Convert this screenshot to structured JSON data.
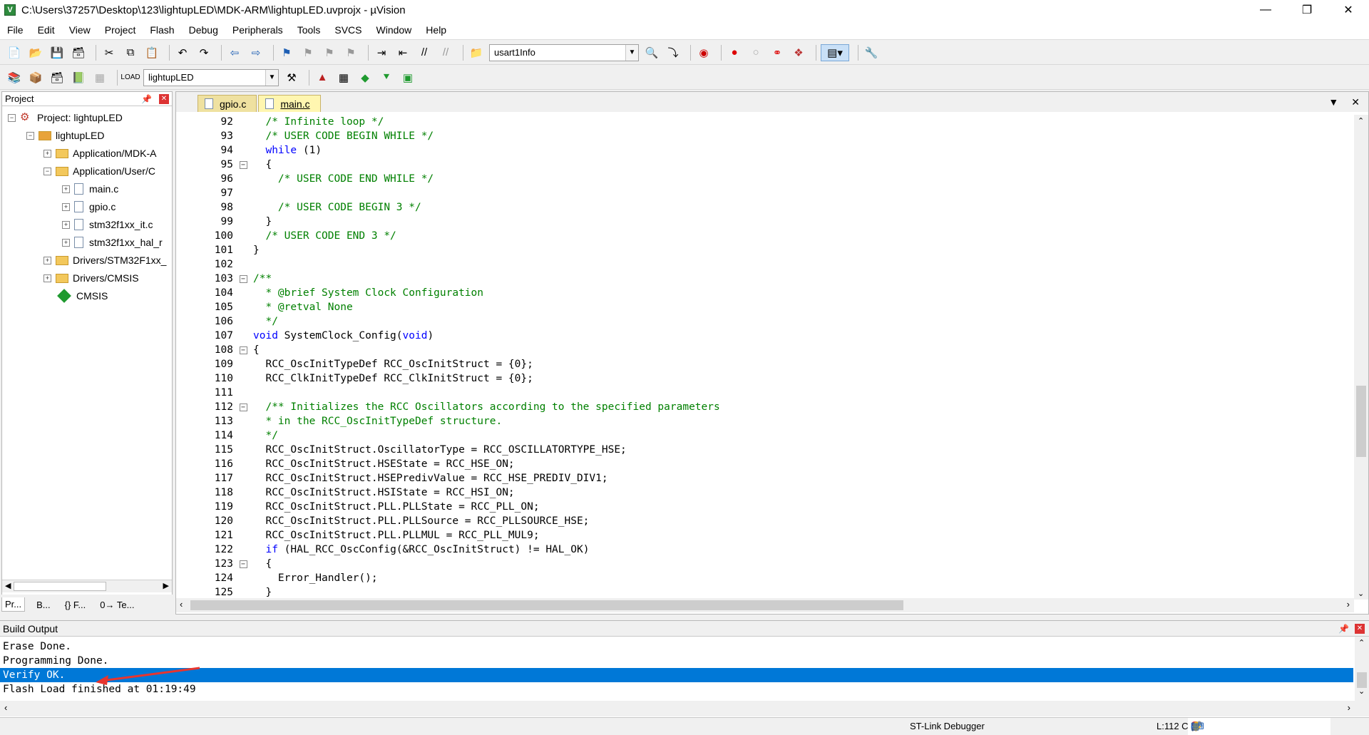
{
  "window": {
    "title": "C:\\Users\\37257\\Desktop\\123\\lightupLED\\MDK-ARM\\lightupLED.uvprojx - µVision"
  },
  "menu": [
    "File",
    "Edit",
    "View",
    "Project",
    "Flash",
    "Debug",
    "Peripherals",
    "Tools",
    "SVCS",
    "Window",
    "Help"
  ],
  "toolbar": {
    "find_combo": "usart1Info",
    "target_combo": "lightupLED"
  },
  "project_panel": {
    "title": "Project",
    "root": "Project: lightupLED",
    "target": "lightupLED",
    "groups": [
      "Application/MDK-A",
      "Application/User/C",
      "main.c",
      "gpio.c",
      "stm32f1xx_it.c",
      "stm32f1xx_hal_r",
      "Drivers/STM32F1xx_",
      "Drivers/CMSIS",
      "CMSIS"
    ],
    "tabs": [
      "Pr...",
      "B...",
      "{} F...",
      "0→ Te..."
    ]
  },
  "editor": {
    "tabs": [
      "gpio.c",
      "main.c"
    ],
    "active_tab": "main.c",
    "lines": [
      {
        "n": "92",
        "t": "  /* Infinite loop */",
        "c": "comment"
      },
      {
        "n": "93",
        "t": "  /* USER CODE BEGIN WHILE */",
        "c": "comment"
      },
      {
        "n": "94",
        "t": "  while (1)",
        "c": "kw"
      },
      {
        "n": "95",
        "t": "  {",
        "c": "",
        "f": "-"
      },
      {
        "n": "96",
        "t": "    /* USER CODE END WHILE */",
        "c": "comment"
      },
      {
        "n": "97",
        "t": "",
        "c": ""
      },
      {
        "n": "98",
        "t": "    /* USER CODE BEGIN 3 */",
        "c": "comment"
      },
      {
        "n": "99",
        "t": "  }",
        "c": ""
      },
      {
        "n": "100",
        "t": "  /* USER CODE END 3 */",
        "c": "comment"
      },
      {
        "n": "101",
        "t": "}",
        "c": ""
      },
      {
        "n": "102",
        "t": "",
        "c": ""
      },
      {
        "n": "103",
        "t": "/**",
        "c": "comment",
        "f": "-"
      },
      {
        "n": "104",
        "t": "  * @brief System Clock Configuration",
        "c": "comment"
      },
      {
        "n": "105",
        "t": "  * @retval None",
        "c": "comment"
      },
      {
        "n": "106",
        "t": "  */",
        "c": "comment"
      },
      {
        "n": "107",
        "t": "void SystemClock_Config(void)",
        "c": "kw"
      },
      {
        "n": "108",
        "t": "{",
        "c": "",
        "f": "-"
      },
      {
        "n": "109",
        "t": "  RCC_OscInitTypeDef RCC_OscInitStruct = {0};",
        "c": ""
      },
      {
        "n": "110",
        "t": "  RCC_ClkInitTypeDef RCC_ClkInitStruct = {0};",
        "c": ""
      },
      {
        "n": "111",
        "t": "",
        "c": ""
      },
      {
        "n": "112",
        "t": "  /** Initializes the RCC Oscillators according to the specified parameters",
        "c": "comment",
        "f": "-"
      },
      {
        "n": "113",
        "t": "  * in the RCC_OscInitTypeDef structure.",
        "c": "comment"
      },
      {
        "n": "114",
        "t": "  */",
        "c": "comment"
      },
      {
        "n": "115",
        "t": "  RCC_OscInitStruct.OscillatorType = RCC_OSCILLATORTYPE_HSE;",
        "c": ""
      },
      {
        "n": "116",
        "t": "  RCC_OscInitStruct.HSEState = RCC_HSE_ON;",
        "c": ""
      },
      {
        "n": "117",
        "t": "  RCC_OscInitStruct.HSEPredivValue = RCC_HSE_PREDIV_DIV1;",
        "c": ""
      },
      {
        "n": "118",
        "t": "  RCC_OscInitStruct.HSIState = RCC_HSI_ON;",
        "c": ""
      },
      {
        "n": "119",
        "t": "  RCC_OscInitStruct.PLL.PLLState = RCC_PLL_ON;",
        "c": ""
      },
      {
        "n": "120",
        "t": "  RCC_OscInitStruct.PLL.PLLSource = RCC_PLLSOURCE_HSE;",
        "c": ""
      },
      {
        "n": "121",
        "t": "  RCC_OscInitStruct.PLL.PLLMUL = RCC_PLL_MUL9;",
        "c": ""
      },
      {
        "n": "122",
        "t": "  if (HAL_RCC_OscConfig(&RCC_OscInitStruct) != HAL_OK)",
        "c": "kw"
      },
      {
        "n": "123",
        "t": "  {",
        "c": "",
        "f": "-"
      },
      {
        "n": "124",
        "t": "    Error_Handler();",
        "c": ""
      },
      {
        "n": "125",
        "t": "  }",
        "c": ""
      }
    ]
  },
  "build_output": {
    "title": "Build Output",
    "lines": [
      "Erase Done.",
      "Programming Done.",
      "Verify OK.",
      "Flash Load finished at 01:19:49"
    ],
    "selected_index": 2
  },
  "statusbar": {
    "debugger": "ST-Link Debugger",
    "position": "L:112 C"
  },
  "colors": {
    "selection": "#0078d7",
    "comment": "#008000",
    "keyword": "#0000ff",
    "tab_active": "#fff6b0"
  }
}
